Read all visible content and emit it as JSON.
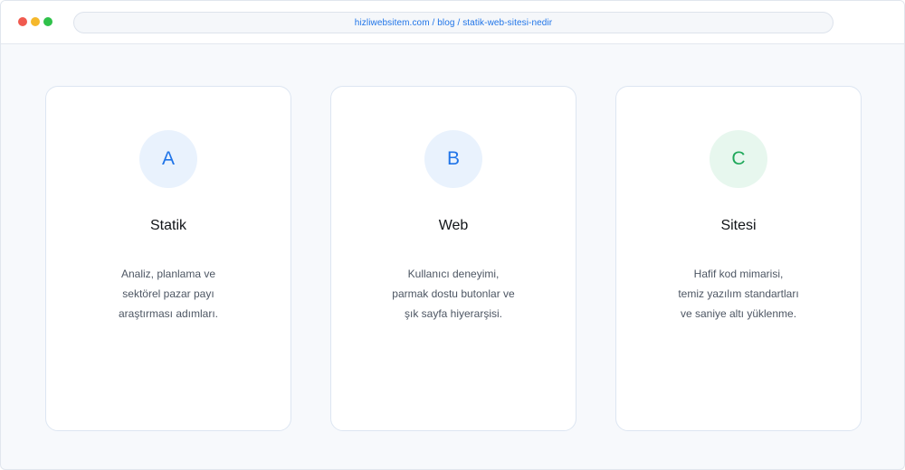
{
  "colors": {
    "accent": "#1f74e8",
    "dot_red": "#f05a4f",
    "dot_yellow": "#f5b82c",
    "dot_green": "#2fc14a"
  },
  "browser": {
    "url": "hizliwebsitem.com / blog / statik-web-sitesi-nedir"
  },
  "cards": [
    {
      "letter": "A",
      "title": "Statik",
      "lines": [
        "Analiz, planlama ve",
        "sektörel pazar payı",
        "araştırması adımları."
      ],
      "circle_bg": "#e9f2fd",
      "letter_color": "#1f74e8"
    },
    {
      "letter": "B",
      "title": "Web",
      "lines": [
        "Kullanıcı deneyimi,",
        "parmak dostu butonlar ve",
        "şık sayfa hiyerarşisi."
      ],
      "circle_bg": "#e9f2fd",
      "letter_color": "#1f74e8"
    },
    {
      "letter": "C",
      "title": "Sitesi",
      "lines": [
        "Hafif kod mimarisi,",
        "temiz yazılım standartları",
        "ve saniye altı yüklenme."
      ],
      "circle_bg": "#e7f7ee",
      "letter_color": "#1fa85a"
    }
  ]
}
